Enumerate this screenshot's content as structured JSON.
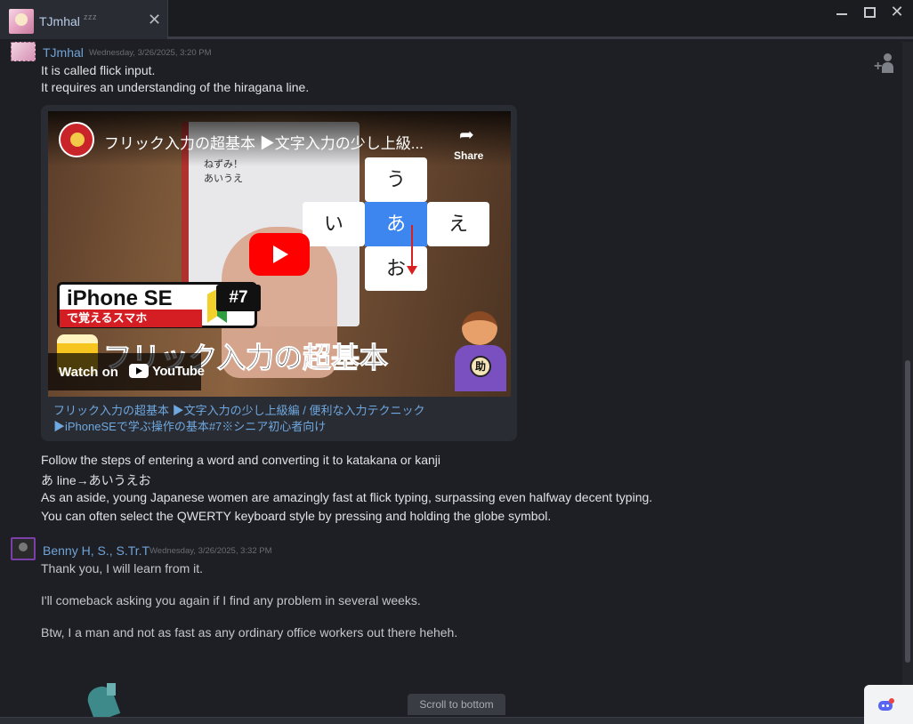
{
  "tab": {
    "name": "TJmhal",
    "status": "zzz",
    "close": "✕"
  },
  "window": {
    "close": "✕"
  },
  "messages": [
    {
      "author": "TJmhal",
      "timestamp": "Wednesday, 3/26/2025, 3:20 PM",
      "lines": [
        "It is called flick input.",
        "It requires an understanding of the hiragana line."
      ],
      "embed": {
        "video_title": "フリック入力の超基本 ▶文字入力の少し上級...",
        "share_label": "Share",
        "watch_on": "Watch on",
        "youtube": "YouTube",
        "phone_text_1": "ねずみ！",
        "phone_text_2": "あいうえ",
        "keys": {
          "u": "う",
          "i": "い",
          "a": "あ",
          "e": "え",
          "o": "お"
        },
        "badge_title": "iPhone SE",
        "badge_sub": "で覚えるスマホ",
        "badge_num": "#7",
        "big_title": "フリック入力の超基本",
        "mascot_badge": "助",
        "link_text": "フリック入力の超基本 ▶文字入力の少し上級編 / 便利な入力テクニック▶iPhoneSEで学ぶ操作の基本#7※シニア初心者向け"
      },
      "after_lines": [
        "Follow the steps of entering a word and converting it to katakana or kanji",
        "あ line→あいうえお",
        "As an aside, young Japanese women are amazingly fast at flick typing, surpassing even halfway decent typing.",
        "You can often select the QWERTY keyboard style by pressing and holding the globe symbol."
      ]
    },
    {
      "author": "Benny H, S., S.Tr.T",
      "timestamp": "Wednesday, 3/26/2025, 3:32 PM",
      "lines": [
        "Thank you, I will learn from it.",
        "I'll comeback asking you again if I find any problem in several weeks.",
        "Btw, I a man and not as fast as any ordinary office workers out there heheh."
      ]
    }
  ],
  "scroll_to_bottom": "Scroll to bottom"
}
